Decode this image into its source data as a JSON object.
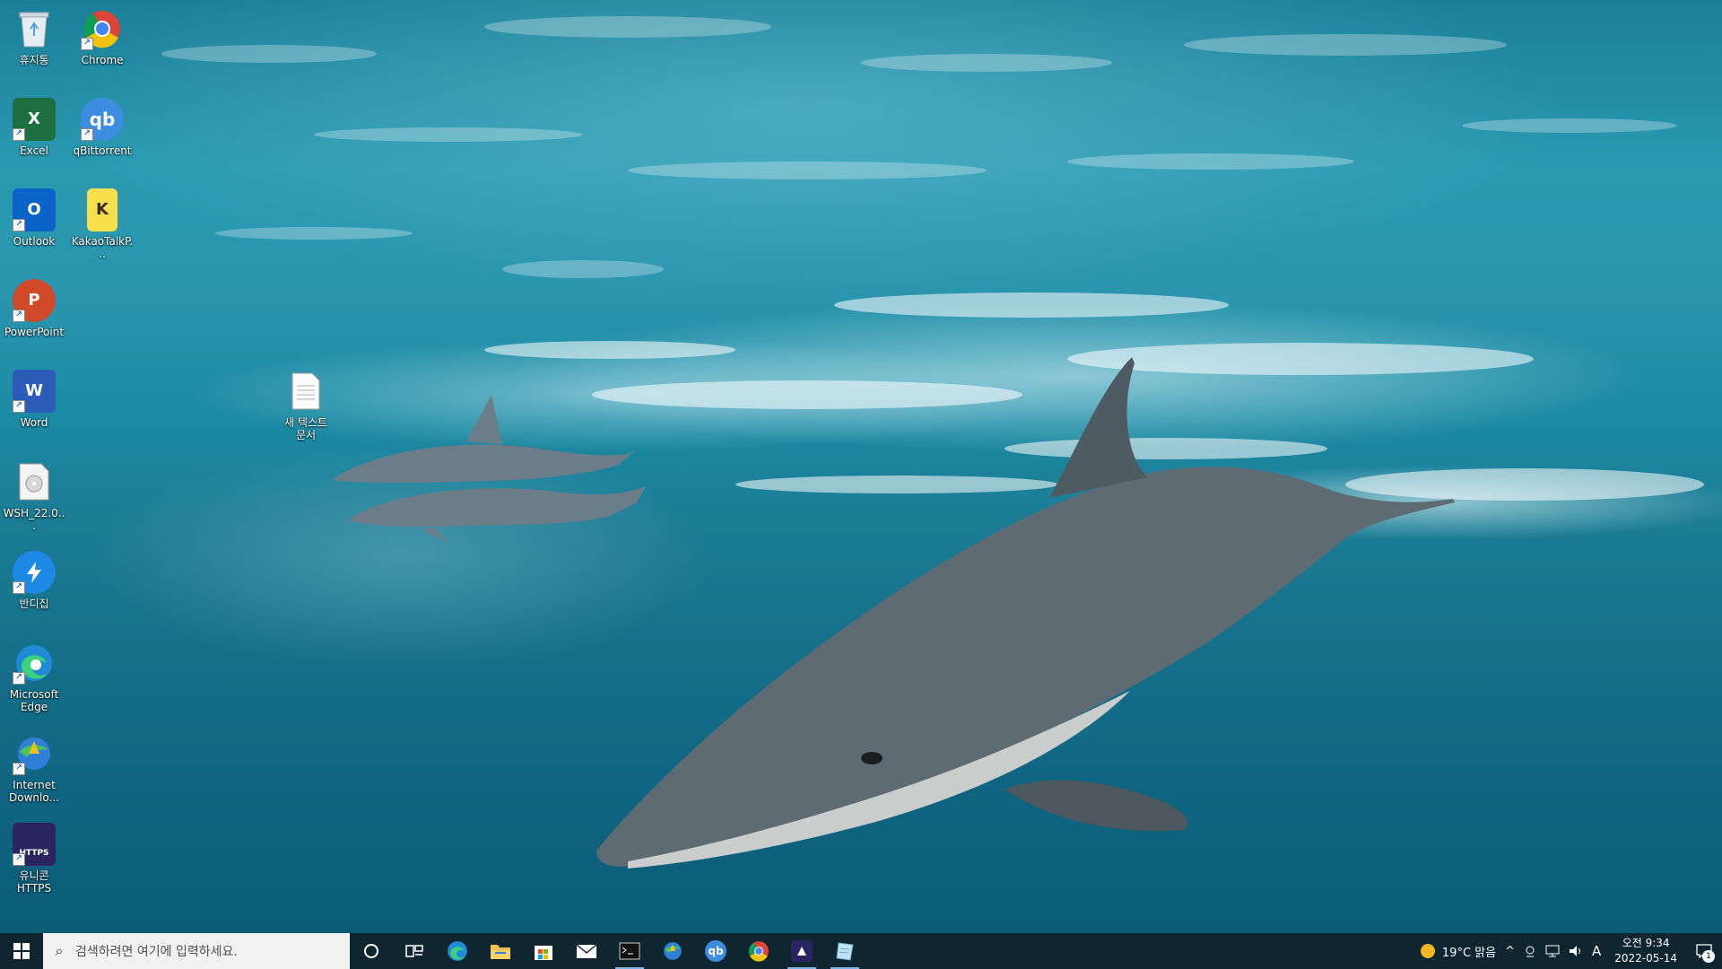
{
  "desktop": {
    "icons": [
      {
        "label": "휴지통",
        "icon": "recycle-bin-icon"
      },
      {
        "label": "Chrome",
        "icon": "chrome-icon"
      },
      {
        "label": "Excel",
        "icon": "excel-icon",
        "glyph": "X"
      },
      {
        "label": "qBittorrent",
        "icon": "qbittorrent-icon",
        "glyph": "qb"
      },
      {
        "label": "Outlook",
        "icon": "outlook-icon",
        "glyph": "O"
      },
      {
        "label": "KakaoTalkP...",
        "icon": "kakaotalk-icon",
        "glyph": "K"
      },
      {
        "label": "PowerPoint",
        "icon": "powerpoint-icon",
        "glyph": "P"
      },
      {
        "label": "Word",
        "icon": "word-icon",
        "glyph": "W"
      },
      {
        "label": "WSH_22.0...",
        "icon": "disc-image-icon"
      },
      {
        "label": "반디집",
        "icon": "bandizip-icon"
      },
      {
        "label": "Microsoft Edge",
        "icon": "edge-icon"
      },
      {
        "label": "Internet Downlo...",
        "icon": "internet-download-manager-icon"
      },
      {
        "label": "유니콘 HTTPS",
        "icon": "unicorn-https-icon",
        "glyph": "HTTPS"
      },
      {
        "label": "새 텍스트 문서",
        "icon": "text-document-icon"
      }
    ]
  },
  "taskbar": {
    "search_placeholder": "검색하려면 여기에 입력하세요.",
    "pinned": [
      {
        "name": "cortana-icon"
      },
      {
        "name": "task-view-icon"
      },
      {
        "name": "edge-icon"
      },
      {
        "name": "file-explorer-icon"
      },
      {
        "name": "microsoft-store-icon"
      },
      {
        "name": "mail-icon"
      },
      {
        "name": "terminal-icon"
      },
      {
        "name": "internet-download-manager-icon"
      },
      {
        "name": "qbittorrent-icon",
        "glyph": "qb"
      },
      {
        "name": "chrome-icon"
      },
      {
        "name": "unicorn-https-icon"
      },
      {
        "name": "notepad-icon"
      }
    ],
    "tray": {
      "weather": "19°C  맑음",
      "ime": "A",
      "time": "오전 9:34",
      "date": "2022-05-14",
      "notification_count": "1"
    }
  },
  "colors": {
    "taskbar": "#0f2530",
    "excel": "#1d6f42",
    "outlook": "#0a64c8",
    "powerpoint": "#d04a2a",
    "word": "#2b5cb8",
    "qbittorrent": "#3c8ce0",
    "kakaotalk": "#f7e04b",
    "unicorn": "#2a2560"
  }
}
